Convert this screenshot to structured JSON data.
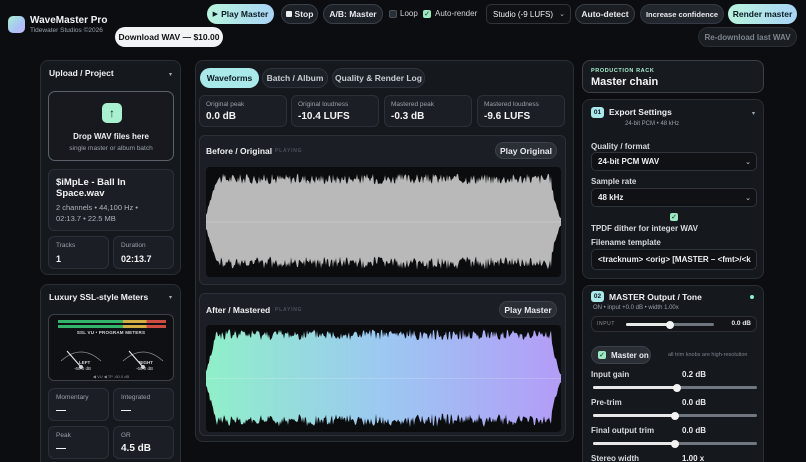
{
  "app": {
    "name": "WaveMaster Pro",
    "subtitle": "Tidewater Studios ©2026",
    "download_label": "Download WAV — $10.00"
  },
  "toolbar": {
    "play_master": "Play Master",
    "stop": "Stop",
    "ab_master": "A/B: Master",
    "loop_label": "Loop",
    "loop_checked": false,
    "autorender_label": "Auto-render",
    "autorender_checked": true,
    "preset_value": "Studio (-9 LUFS)",
    "autodetect": "Auto-detect",
    "increase_confidence": "Increase confidence",
    "render_master": "Render master",
    "redownload": "Re-download last WAV"
  },
  "upload": {
    "title": "Upload / Project",
    "drop_title": "Drop WAV files here",
    "drop_sub": "single master or album batch",
    "file_name": "$iMpLe - Ball In Space.wav",
    "file_meta1": "2 channels • 44,100 Hz •",
    "file_meta2": "02:13.7 • 22.5 MB",
    "tracks_label": "Tracks",
    "tracks_value": "1",
    "duration_label": "Duration",
    "duration_value": "02:13.7"
  },
  "meters": {
    "title": "Luxury SSL-style Meters",
    "vu_header": "SSL VU • PROGRAM METERS",
    "left_label": "LEFT",
    "left_value": "-60.0 dB",
    "right_label": "RIGHT",
    "right_value": "-60.0 dB",
    "scale_text": "◀ VU ◀ TP -60.0 dB",
    "momentary_label": "Momentary",
    "momentary_value": "—",
    "integrated_label": "Integrated",
    "integrated_value": "—",
    "peak_label": "Peak",
    "peak_value": "—",
    "gr_label": "GR",
    "gr_value": "4.5 dB"
  },
  "tabs": [
    {
      "label": "Waveforms",
      "active": true
    },
    {
      "label": "Batch / Album",
      "active": false
    },
    {
      "label": "Quality & Render Log",
      "active": false
    }
  ],
  "stats": [
    {
      "label": "Original peak",
      "value": "0.0 dB"
    },
    {
      "label": "Original loudness",
      "value": "-10.4 LUFS"
    },
    {
      "label": "Mastered peak",
      "value": "-0.3 dB"
    },
    {
      "label": "Mastered loudness",
      "value": "-9.6 LUFS"
    }
  ],
  "waves": {
    "before_title": "Before / Original",
    "before_status": "PLAYING",
    "play_original": "Play Original",
    "after_title": "After / Mastered",
    "after_status": "PLAYING",
    "play_master": "Play Master"
  },
  "rack": {
    "kicker": "PRODUCTION RACK",
    "title": "Master chain"
  },
  "export": {
    "num": "01",
    "title": "Export Settings",
    "sub": "24-bit PCM • 48 kHz",
    "quality_label": "Quality / format",
    "quality_value": "24-bit PCM WAV",
    "rate_label": "Sample rate",
    "rate_value": "48 kHz",
    "dither_checked": true,
    "dither_label": "TPDF dither for integer WAV",
    "filename_label": "Filename template",
    "filename_value": "<tracknum> <orig> [MASTER – <fmt>/<k"
  },
  "master_out": {
    "num": "02",
    "title": "MASTER Output / Tone",
    "sub": "ON • input +0.0 dB • width 1.00x",
    "input_label": "INPUT",
    "input_value": "0.0 dB",
    "input_level": 0.5,
    "master_on_label": "Master on",
    "master_on_checked": true,
    "hint": "all trim knobs are high-resolution",
    "controls": [
      {
        "label": "Input gain",
        "value": "0.2 dB",
        "level": 0.51
      },
      {
        "label": "Pre-trim",
        "value": "0.0 dB",
        "level": 0.5
      },
      {
        "label": "Final output trim",
        "value": "0.0 dB",
        "level": 0.5
      },
      {
        "label": "Stereo width",
        "value": "1.00 x",
        "level": 0.5
      }
    ]
  },
  "colors": {
    "accent_mint": "#a9f0d1",
    "accent_blue": "#a9d4f6",
    "panel": "#15181d",
    "wave_after_start": "#8ff0c8",
    "wave_after_end": "#b39cf7"
  }
}
